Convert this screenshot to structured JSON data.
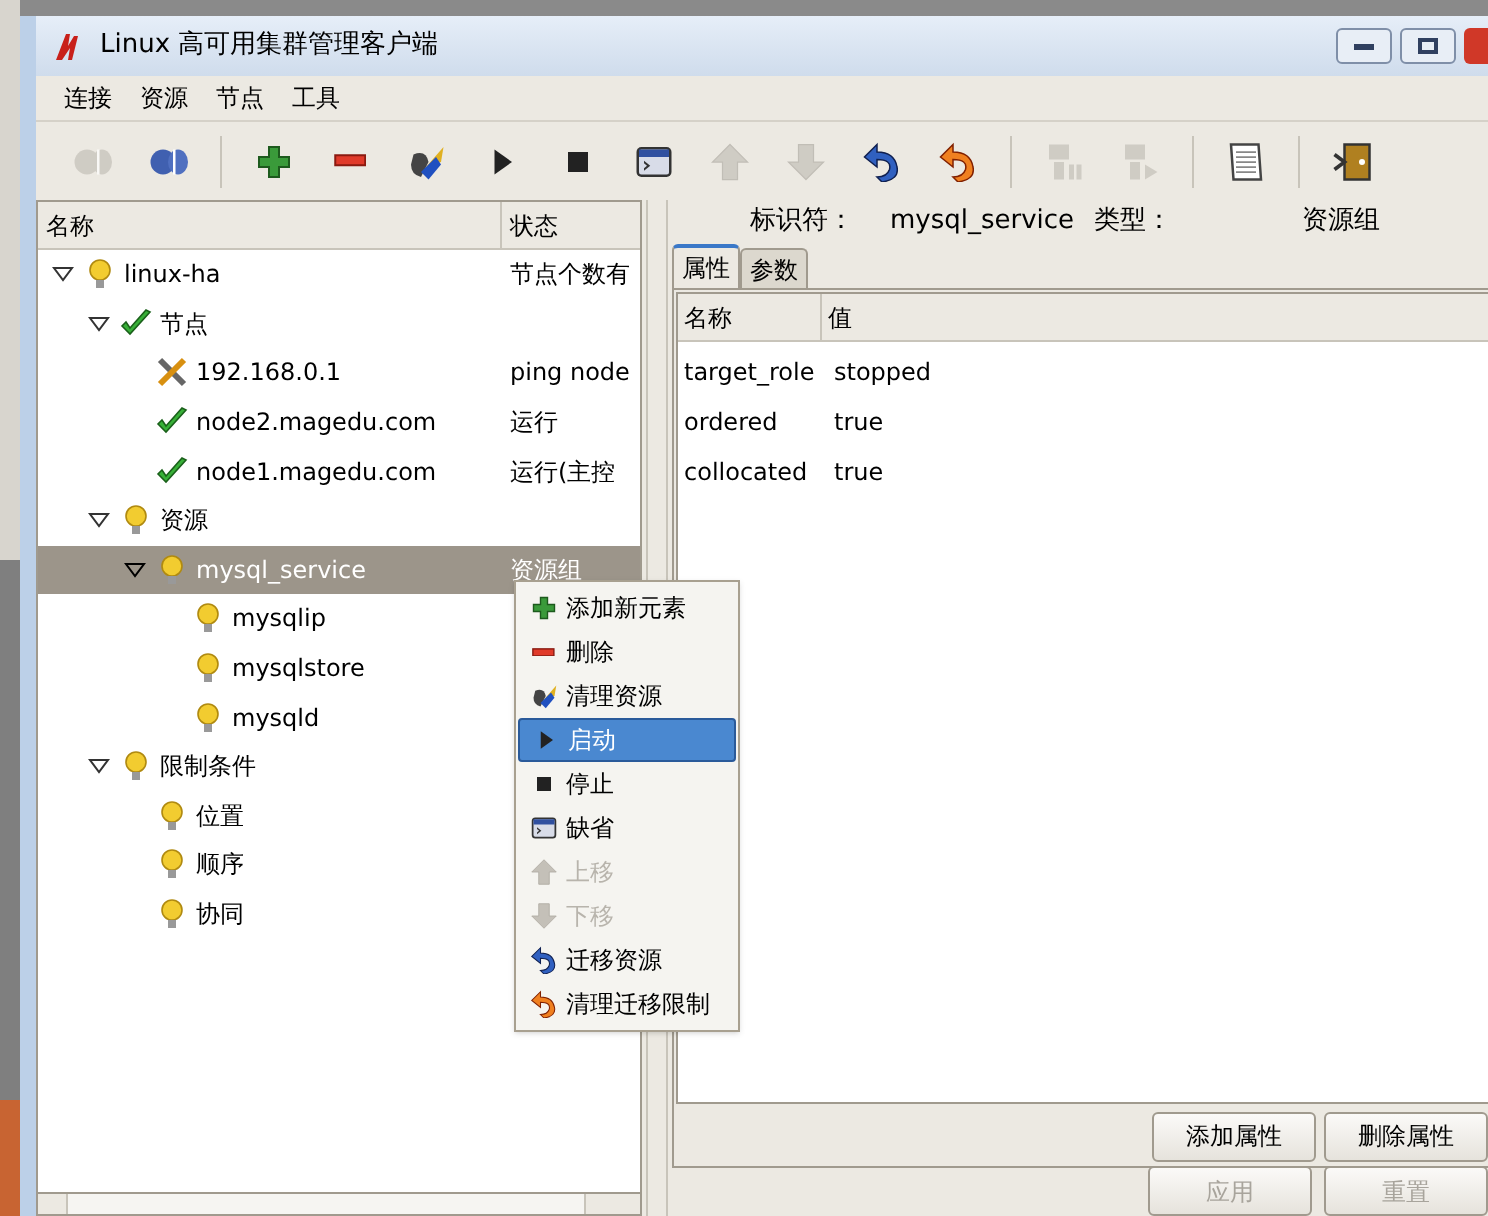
{
  "window": {
    "title": "Linux 高可用集群管理客户端"
  },
  "menu_bar": [
    "连接",
    "资源",
    "节点",
    "工具"
  ],
  "toolbar": [
    {
      "kind": "plug",
      "disabled": true
    },
    {
      "kind": "plug",
      "disabled": false
    },
    {
      "kind": "sep"
    },
    {
      "kind": "plus",
      "disabled": false
    },
    {
      "kind": "minus",
      "disabled": false
    },
    {
      "kind": "broom",
      "disabled": false
    },
    {
      "kind": "play",
      "disabled": false
    },
    {
      "kind": "stop",
      "disabled": false
    },
    {
      "kind": "console",
      "disabled": false
    },
    {
      "kind": "up",
      "disabled": true
    },
    {
      "kind": "down",
      "disabled": true
    },
    {
      "kind": "undo",
      "disabled": false
    },
    {
      "kind": "undo_orange",
      "disabled": false
    },
    {
      "kind": "sep"
    },
    {
      "kind": "standby",
      "disabled": true
    },
    {
      "kind": "active",
      "disabled": true
    },
    {
      "kind": "sep"
    },
    {
      "kind": "doc",
      "disabled": false
    },
    {
      "kind": "sep"
    },
    {
      "kind": "exit",
      "disabled": false
    }
  ],
  "tree": {
    "columns": [
      "名称",
      "状态"
    ],
    "items": [
      {
        "label": "linux-ha",
        "kind": "bulb",
        "status": "节点个数有",
        "selected": false,
        "expanded": true,
        "children": [
          {
            "label": "节点",
            "kind": "check",
            "selected": false,
            "expanded": true,
            "children": [
              {
                "label": "192.168.0.1",
                "kind": "tools",
                "status": "ping node",
                "selected": false
              },
              {
                "label": "node2.magedu.com",
                "kind": "check",
                "status": "运行",
                "selected": false
              },
              {
                "label": "node1.magedu.com",
                "kind": "check",
                "status": "运行(主控",
                "selected": false
              }
            ]
          },
          {
            "label": "资源",
            "kind": "bulb",
            "selected": false,
            "expanded": true,
            "children": [
              {
                "label": "mysql_service",
                "kind": "bulb",
                "status": "资源组",
                "selected": true,
                "expanded": true,
                "children": [
                  {
                    "label": "mysqlip",
                    "kind": "bulb",
                    "selected": false
                  },
                  {
                    "label": "mysqlstore",
                    "kind": "bulb",
                    "selected": false
                  },
                  {
                    "label": "mysqld",
                    "kind": "bulb",
                    "selected": false
                  }
                ]
              }
            ]
          },
          {
            "label": "限制条件",
            "kind": "bulb",
            "selected": false,
            "expanded": true,
            "children": [
              {
                "label": "位置",
                "kind": "bulb",
                "selected": false
              },
              {
                "label": "顺序",
                "kind": "bulb",
                "selected": false
              },
              {
                "label": "协同",
                "kind": "bulb",
                "selected": false
              }
            ]
          }
        ]
      }
    ]
  },
  "context_menu": [
    {
      "label": "添加新元素",
      "kind": "plus",
      "selected": false,
      "disabled": false
    },
    {
      "label": "删除",
      "kind": "minus",
      "selected": false,
      "disabled": false
    },
    {
      "label": "清理资源",
      "kind": "broom",
      "selected": false,
      "disabled": false
    },
    {
      "label": "启动",
      "kind": "play",
      "selected": true,
      "disabled": false
    },
    {
      "label": "停止",
      "kind": "stop",
      "selected": false,
      "disabled": false
    },
    {
      "label": "缺省",
      "kind": "console",
      "selected": false,
      "disabled": false
    },
    {
      "label": "上移",
      "kind": "up",
      "selected": false,
      "disabled": true
    },
    {
      "label": "下移",
      "kind": "down",
      "selected": false,
      "disabled": true
    },
    {
      "label": "迁移资源",
      "kind": "undo",
      "selected": false,
      "disabled": false
    },
    {
      "label": "清理迁移限制",
      "kind": "undo_orange",
      "selected": false,
      "disabled": false
    }
  ],
  "details": {
    "id_label": "标识符：",
    "id_value": "mysql_service",
    "type_label": "类型：",
    "type_value": "资源组",
    "tabs": [
      {
        "label": "属性",
        "selected": true
      },
      {
        "label": "参数",
        "selected": false
      }
    ],
    "table": {
      "columns": [
        "名称",
        "值"
      ],
      "rows": [
        [
          "target_role",
          "stopped"
        ],
        [
          "ordered",
          "true"
        ],
        [
          "collocated",
          "true"
        ]
      ]
    },
    "buttons": [
      {
        "label": "添加属性",
        "disabled": false
      },
      {
        "label": "删除属性",
        "disabled": false
      }
    ],
    "footer_buttons": [
      {
        "label": "应用",
        "disabled": true
      },
      {
        "label": "重置",
        "disabled": true
      }
    ]
  }
}
